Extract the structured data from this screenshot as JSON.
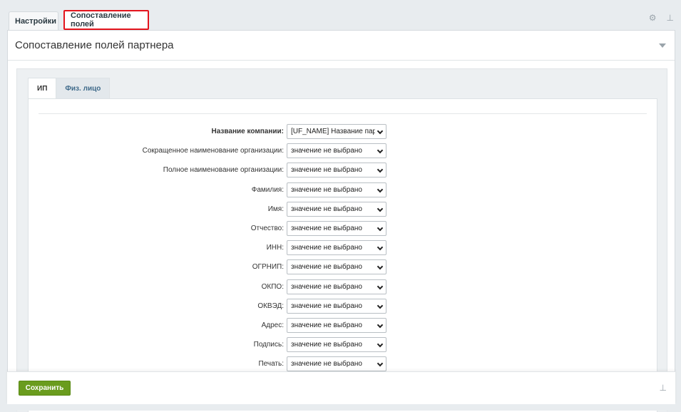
{
  "top_tabs": [
    "Настройки",
    "Сопоставление полей"
  ],
  "panel": {
    "title": "Сопоставление полей партнера"
  },
  "inner_tabs": [
    "ИП",
    "Физ. лицо"
  ],
  "fields": [
    {
      "label": "Название компании:",
      "value": "[UF_NAME] Название партнера",
      "bold": true
    },
    {
      "label": "Сокращенное наименование организации:",
      "value": "значение не выбрано"
    },
    {
      "label": "Полное наименование организации:",
      "value": "значение не выбрано"
    },
    {
      "label": "Фамилия:",
      "value": "значение не выбрано"
    },
    {
      "label": "Имя:",
      "value": "значение не выбрано"
    },
    {
      "label": "Отчество:",
      "value": "значение не выбрано"
    },
    {
      "label": "ИНН:",
      "value": "значение не выбрано"
    },
    {
      "label": "ОГРНИП:",
      "value": "значение не выбрано"
    },
    {
      "label": "ОКПО:",
      "value": "значение не выбрано"
    },
    {
      "label": "ОКВЭД:",
      "value": "значение не выбрано"
    },
    {
      "label": "Адрес:",
      "value": "значение не выбрано"
    },
    {
      "label": "Подпись:",
      "value": "значение не выбрано"
    },
    {
      "label": "Печать:",
      "value": "значение не выбрано"
    }
  ],
  "footer": {
    "save_label": "Сохранить"
  },
  "icons": {
    "settings": "gear-icon",
    "pin": "pin-icon",
    "collapse": "triangle-down-icon"
  },
  "colors": {
    "highlight": "#e3141d",
    "save_button": "#6a9c1e",
    "inactive_tab_text": "#3f6a8a"
  }
}
